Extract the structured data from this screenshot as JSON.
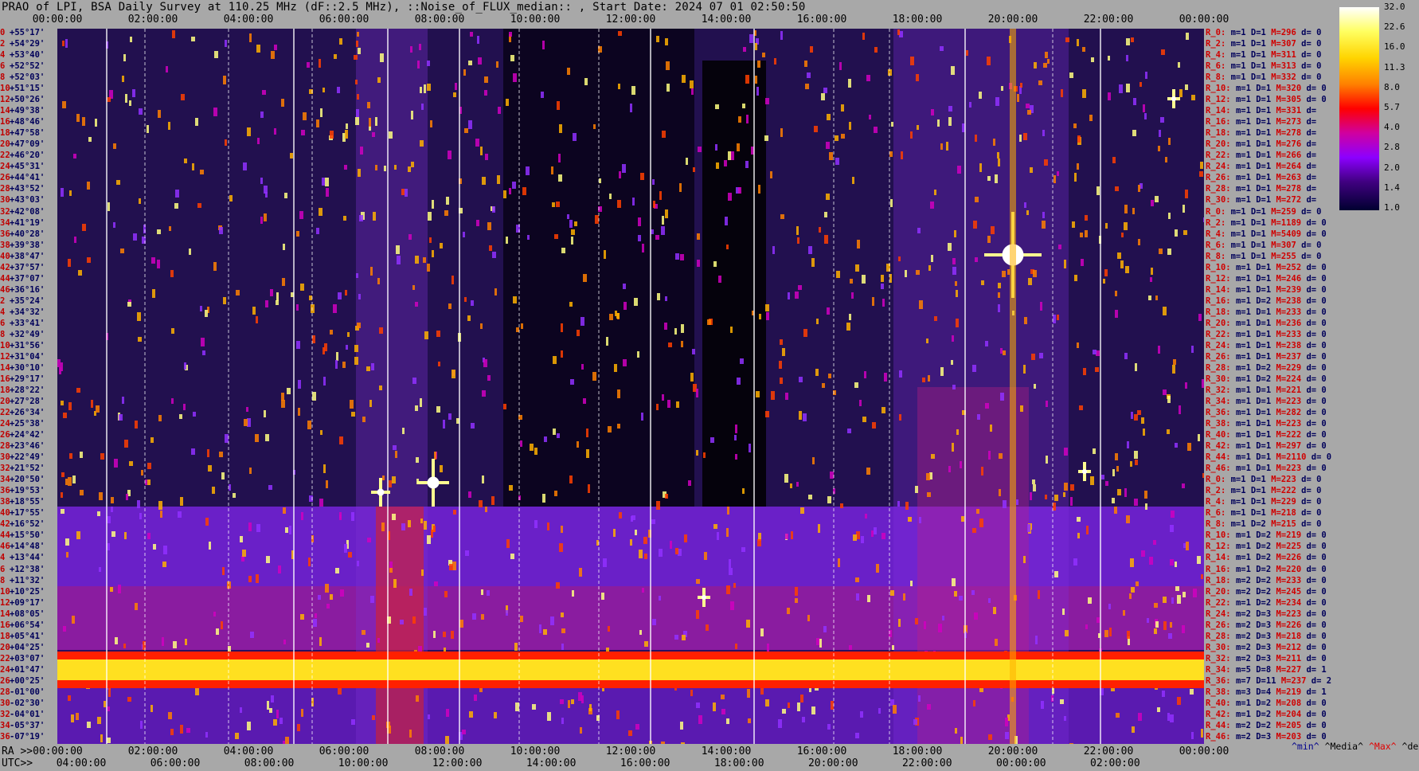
{
  "title": "PRAO of LPI, BSA Daily Survey at 110.25 MHz (dF::2.5 MHz), ::Noise_of_FLUX_median:: , Start Date: 2024 07 01 02:50:50",
  "top_axis": [
    "00:00:00",
    "02:00:00",
    "04:00:00",
    "06:00:00",
    "08:00:00",
    "10:00:00",
    "12:00:00",
    "14:00:00",
    "16:00:00",
    "18:00:00",
    "20:00:00",
    "22:00:00",
    "00:00:00"
  ],
  "bottom_axis": {
    "ra_label": "RA >>00:00:00",
    "utc_label": "UTC>>",
    "ra_ticks": [
      "02:00:00",
      "04:00:00",
      "06:00:00",
      "08:00:00",
      "10:00:00",
      "12:00:00",
      "14:00:00",
      "16:00:00",
      "18:00:00",
      "20:00:00",
      "22:00:00",
      "00:00:00"
    ],
    "utc_ticks": [
      "04:00:00",
      "06:00:00",
      "08:00:00",
      "10:00:00",
      "12:00:00",
      "14:00:00",
      "16:00:00",
      "18:00:00",
      "20:00:00",
      "22:00:00",
      "00:00:00",
      "02:00:00"
    ]
  },
  "colorbar": {
    "labels": [
      "32.0",
      "22.6",
      "16.0",
      "11.3",
      "8.0",
      "5.7",
      "4.0",
      "2.8",
      "2.0",
      "1.4",
      "1.0"
    ]
  },
  "declinations": [
    {
      "idx": "0",
      "dec": "+55°17'"
    },
    {
      "idx": "2",
      "dec": "+54°29'"
    },
    {
      "idx": "4",
      "dec": "+53°40'"
    },
    {
      "idx": "6",
      "dec": "+52°52'"
    },
    {
      "idx": "8",
      "dec": "+52°03'"
    },
    {
      "idx": "10",
      "dec": "+51°15'"
    },
    {
      "idx": "12",
      "dec": "+50°26'"
    },
    {
      "idx": "14",
      "dec": "+49°38'"
    },
    {
      "idx": "16",
      "dec": "+48°46'"
    },
    {
      "idx": "18",
      "dec": "+47°58'"
    },
    {
      "idx": "20",
      "dec": "+47°09'"
    },
    {
      "idx": "22",
      "dec": "+46°20'"
    },
    {
      "idx": "24",
      "dec": "+45°31'"
    },
    {
      "idx": "26",
      "dec": "+44°41'"
    },
    {
      "idx": "28",
      "dec": "+43°52'"
    },
    {
      "idx": "30",
      "dec": "+43°03'"
    },
    {
      "idx": "32",
      "dec": "+42°08'"
    },
    {
      "idx": "34",
      "dec": "+41°19'"
    },
    {
      "idx": "36",
      "dec": "+40°28'"
    },
    {
      "idx": "38",
      "dec": "+39°38'"
    },
    {
      "idx": "40",
      "dec": "+38°47'"
    },
    {
      "idx": "42",
      "dec": "+37°57'"
    },
    {
      "idx": "44",
      "dec": "+37°07'"
    },
    {
      "idx": "46",
      "dec": "+36°16'"
    },
    {
      "idx": "2",
      "dec": "+35°24'"
    },
    {
      "idx": "4",
      "dec": "+34°32'"
    },
    {
      "idx": "6",
      "dec": "+33°41'"
    },
    {
      "idx": "8",
      "dec": "+32°49'"
    },
    {
      "idx": "10",
      "dec": "+31°56'"
    },
    {
      "idx": "12",
      "dec": "+31°04'"
    },
    {
      "idx": "14",
      "dec": "+30°10'"
    },
    {
      "idx": "16",
      "dec": "+29°17'"
    },
    {
      "idx": "18",
      "dec": "+28°22'"
    },
    {
      "idx": "20",
      "dec": "+27°28'"
    },
    {
      "idx": "22",
      "dec": "+26°34'"
    },
    {
      "idx": "24",
      "dec": "+25°38'"
    },
    {
      "idx": "26",
      "dec": "+24°42'"
    },
    {
      "idx": "28",
      "dec": "+23°46'"
    },
    {
      "idx": "30",
      "dec": "+22°49'"
    },
    {
      "idx": "32",
      "dec": "+21°52'"
    },
    {
      "idx": "34",
      "dec": "+20°50'"
    },
    {
      "idx": "36",
      "dec": "+19°53'"
    },
    {
      "idx": "38",
      "dec": "+18°55'"
    },
    {
      "idx": "40",
      "dec": "+17°55'"
    },
    {
      "idx": "42",
      "dec": "+16°52'"
    },
    {
      "idx": "44",
      "dec": "+15°50'"
    },
    {
      "idx": "46",
      "dec": "+14°48'"
    },
    {
      "idx": "4",
      "dec": "+13°44'"
    },
    {
      "idx": "6",
      "dec": "+12°38'"
    },
    {
      "idx": "8",
      "dec": "+11°32'"
    },
    {
      "idx": "10",
      "dec": "+10°25'"
    },
    {
      "idx": "12",
      "dec": "+09°17'"
    },
    {
      "idx": "14",
      "dec": "+08°05'"
    },
    {
      "idx": "16",
      "dec": "+06°54'"
    },
    {
      "idx": "18",
      "dec": "+05°41'"
    },
    {
      "idx": "20",
      "dec": "+04°25'"
    },
    {
      "idx": "22",
      "dec": "+03°07'"
    },
    {
      "idx": "24",
      "dec": "+01°47'"
    },
    {
      "idx": "26",
      "dec": "+00°25'"
    },
    {
      "idx": "28",
      "dec": "-01°00'"
    },
    {
      "idx": "30",
      "dec": "-02°30'"
    },
    {
      "idx": "32",
      "dec": "-04°01'"
    },
    {
      "idx": "34",
      "dec": "-05°37'"
    },
    {
      "idx": "36",
      "dec": "-07°19'"
    }
  ],
  "stats": [
    {
      "r": "R_0:",
      "m": "m=1",
      "d": "D=1",
      "mm": "M=296",
      "dv": "d= 0"
    },
    {
      "r": "R_2:",
      "m": "m=1",
      "d": "D=1",
      "mm": "M=307",
      "dv": "d= 0"
    },
    {
      "r": "R_4:",
      "m": "m=1",
      "d": "D=1",
      "mm": "M=311",
      "dv": "d= 0"
    },
    {
      "r": "R_6:",
      "m": "m=1",
      "d": "D=1",
      "mm": "M=313",
      "dv": "d= 0"
    },
    {
      "r": "R_8:",
      "m": "m=1",
      "d": "D=1",
      "mm": "M=332",
      "dv": "d= 0"
    },
    {
      "r": "R_10:",
      "m": "m=1",
      "d": "D=1",
      "mm": "M=320",
      "dv": "d= 0"
    },
    {
      "r": "R_12:",
      "m": "m=1",
      "d": "D=1",
      "mm": "M=305",
      "dv": "d= 0"
    },
    {
      "r": "R_14:",
      "m": "m=1",
      "d": "D=1",
      "mm": "M=331",
      "dv": "d="
    },
    {
      "r": "R_16:",
      "m": "m=1",
      "d": "D=1",
      "mm": "M=273",
      "dv": "d="
    },
    {
      "r": "R_18:",
      "m": "m=1",
      "d": "D=1",
      "mm": "M=278",
      "dv": "d="
    },
    {
      "r": "R_20:",
      "m": "m=1",
      "d": "D=1",
      "mm": "M=276",
      "dv": "d="
    },
    {
      "r": "R_22:",
      "m": "m=1",
      "d": "D=1",
      "mm": "M=266",
      "dv": "d="
    },
    {
      "r": "R_24:",
      "m": "m=1",
      "d": "D=1",
      "mm": "M=264",
      "dv": "d="
    },
    {
      "r": "R_26:",
      "m": "m=1",
      "d": "D=1",
      "mm": "M=263",
      "dv": "d="
    },
    {
      "r": "R_28:",
      "m": "m=1",
      "d": "D=1",
      "mm": "M=278",
      "dv": "d="
    },
    {
      "r": "R_30:",
      "m": "m=1",
      "d": "D=1",
      "mm": "M=272",
      "dv": "d="
    },
    {
      "r": "R_0:",
      "m": "m=1",
      "d": "D=1",
      "mm": "M=259",
      "dv": "d= 0"
    },
    {
      "r": "R_2:",
      "m": "m=1",
      "d": "D=1",
      "mm": "M=1189",
      "dv": "d= 0"
    },
    {
      "r": "R_4:",
      "m": "m=1",
      "d": "D=1",
      "mm": "M=5409",
      "dv": "d= 0"
    },
    {
      "r": "R_6:",
      "m": "m=1",
      "d": "D=1",
      "mm": "M=307",
      "dv": "d= 0"
    },
    {
      "r": "R_8:",
      "m": "m=1",
      "d": "D=1",
      "mm": "M=255",
      "dv": "d= 0"
    },
    {
      "r": "R_10:",
      "m": "m=1",
      "d": "D=1",
      "mm": "M=252",
      "dv": "d= 0"
    },
    {
      "r": "R_12:",
      "m": "m=1",
      "d": "D=1",
      "mm": "M=246",
      "dv": "d= 0"
    },
    {
      "r": "R_14:",
      "m": "m=1",
      "d": "D=1",
      "mm": "M=239",
      "dv": "d= 0"
    },
    {
      "r": "R_16:",
      "m": "m=1",
      "d": "D=2",
      "mm": "M=238",
      "dv": "d= 0"
    },
    {
      "r": "R_18:",
      "m": "m=1",
      "d": "D=1",
      "mm": "M=233",
      "dv": "d= 0"
    },
    {
      "r": "R_20:",
      "m": "m=1",
      "d": "D=1",
      "mm": "M=236",
      "dv": "d= 0"
    },
    {
      "r": "R_22:",
      "m": "m=1",
      "d": "D=1",
      "mm": "M=233",
      "dv": "d= 0"
    },
    {
      "r": "R_24:",
      "m": "m=1",
      "d": "D=1",
      "mm": "M=238",
      "dv": "d= 0"
    },
    {
      "r": "R_26:",
      "m": "m=1",
      "d": "D=1",
      "mm": "M=237",
      "dv": "d= 0"
    },
    {
      "r": "R_28:",
      "m": "m=1",
      "d": "D=2",
      "mm": "M=229",
      "dv": "d= 0"
    },
    {
      "r": "R_30:",
      "m": "m=1",
      "d": "D=2",
      "mm": "M=224",
      "dv": "d= 0"
    },
    {
      "r": "R_32:",
      "m": "m=1",
      "d": "D=1",
      "mm": "M=221",
      "dv": "d= 0"
    },
    {
      "r": "R_34:",
      "m": "m=1",
      "d": "D=1",
      "mm": "M=223",
      "dv": "d= 0"
    },
    {
      "r": "R_36:",
      "m": "m=1",
      "d": "D=1",
      "mm": "M=282",
      "dv": "d= 0"
    },
    {
      "r": "R_38:",
      "m": "m=1",
      "d": "D=1",
      "mm": "M=223",
      "dv": "d= 0"
    },
    {
      "r": "R_40:",
      "m": "m=1",
      "d": "D=1",
      "mm": "M=222",
      "dv": "d= 0"
    },
    {
      "r": "R_42:",
      "m": "m=1",
      "d": "D=1",
      "mm": "M=297",
      "dv": "d= 0"
    },
    {
      "r": "R_44:",
      "m": "m=1",
      "d": "D=1",
      "mm": "M=2110",
      "dv": "d= 0"
    },
    {
      "r": "R_46:",
      "m": "m=1",
      "d": "D=1",
      "mm": "M=223",
      "dv": "d= 0"
    },
    {
      "r": "R_0:",
      "m": "m=1",
      "d": "D=1",
      "mm": "M=223",
      "dv": "d= 0"
    },
    {
      "r": "R_2:",
      "m": "m=1",
      "d": "D=1",
      "mm": "M=222",
      "dv": "d= 0"
    },
    {
      "r": "R_4:",
      "m": "m=1",
      "d": "D=1",
      "mm": "M=229",
      "dv": "d= 0"
    },
    {
      "r": "R_6:",
      "m": "m=1",
      "d": "D=1",
      "mm": "M=218",
      "dv": "d= 0"
    },
    {
      "r": "R_8:",
      "m": "m=1",
      "d": "D=2",
      "mm": "M=215",
      "dv": "d= 0"
    },
    {
      "r": "R_10:",
      "m": "m=1",
      "d": "D=2",
      "mm": "M=219",
      "dv": "d= 0"
    },
    {
      "r": "R_12:",
      "m": "m=1",
      "d": "D=2",
      "mm": "M=225",
      "dv": "d= 0"
    },
    {
      "r": "R_14:",
      "m": "m=1",
      "d": "D=2",
      "mm": "M=226",
      "dv": "d= 0"
    },
    {
      "r": "R_16:",
      "m": "m=1",
      "d": "D=2",
      "mm": "M=220",
      "dv": "d= 0"
    },
    {
      "r": "R_18:",
      "m": "m=2",
      "d": "D=2",
      "mm": "M=233",
      "dv": "d= 0"
    },
    {
      "r": "R_20:",
      "m": "m=2",
      "d": "D=2",
      "mm": "M=245",
      "dv": "d= 0"
    },
    {
      "r": "R_22:",
      "m": "m=1",
      "d": "D=2",
      "mm": "M=234",
      "dv": "d= 0"
    },
    {
      "r": "R_24:",
      "m": "m=2",
      "d": "D=3",
      "mm": "M=223",
      "dv": "d= 0"
    },
    {
      "r": "R_26:",
      "m": "m=2",
      "d": "D=3",
      "mm": "M=226",
      "dv": "d= 0"
    },
    {
      "r": "R_28:",
      "m": "m=2",
      "d": "D=3",
      "mm": "M=218",
      "dv": "d= 0"
    },
    {
      "r": "R_30:",
      "m": "m=2",
      "d": "D=3",
      "mm": "M=212",
      "dv": "d= 0"
    },
    {
      "r": "R_32:",
      "m": "m=2",
      "d": "D=3",
      "mm": "M=211",
      "dv": "d= 0"
    },
    {
      "r": "R_34:",
      "m": "m=5",
      "d": "D=8",
      "mm": "M=227",
      "dv": "d= 1"
    },
    {
      "r": "R_36:",
      "m": "m=7",
      "d": "D=11",
      "mm": "M=237",
      "dv": "d= 2"
    },
    {
      "r": "R_38:",
      "m": "m=3",
      "d": "D=4",
      "mm": "M=219",
      "dv": "d= 1"
    },
    {
      "r": "R_40:",
      "m": "m=1",
      "d": "D=2",
      "mm": "M=208",
      "dv": "d= 0"
    },
    {
      "r": "R_42:",
      "m": "m=1",
      "d": "D=2",
      "mm": "M=204",
      "dv": "d= 0"
    },
    {
      "r": "R_44:",
      "m": "m=2",
      "d": "D=2",
      "mm": "M=205",
      "dv": "d= 0"
    },
    {
      "r": "R_46:",
      "m": "m=2",
      "d": "D=3",
      "mm": "M=203",
      "dv": "d= 0"
    }
  ],
  "legend": {
    "min": "^min^",
    "media": "^Media^",
    "max": "^Max^",
    "devia": "^devia^"
  },
  "chart_data": {
    "type": "heatmap",
    "title": "PRAO of LPI, BSA Daily Survey at 110.25 MHz (dF::2.5 MHz), ::Noise_of_FLUX_median:: , Start Date: 2024 07 01 02:50:50",
    "xlabel": "RA / UTC",
    "ylabel": "",
    "colorbar_range": [
      1.0,
      32.0
    ],
    "colorbar_scale": "log",
    "colors": {
      "low": "#000030",
      "mid": "#8c00ff",
      "high": "#ff0000",
      "max": "#ffffff"
    }
  }
}
